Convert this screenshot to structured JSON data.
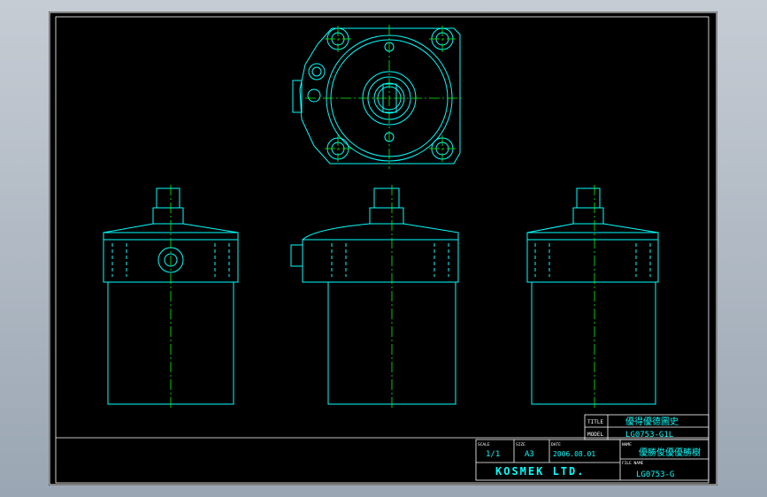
{
  "title_block": {
    "title_label": "TITLE",
    "title_value": "優得優德圖史",
    "model_label": "MODEL",
    "model_value": "LG0753-G1L",
    "scale_label": "SCALE",
    "scale_value": "1/1",
    "size_label": "SIZE",
    "size_value": "A3",
    "date_label": "DATE",
    "date_value": "2006.08.01",
    "name_label": "NAME",
    "name_value": "優勝俊優優勝樹",
    "company": "KOSMEK LTD.",
    "file_label": "FILE NAME",
    "file_value": "LG0753-G"
  },
  "colors": {
    "paper": "#000000",
    "outline": "#00ffff",
    "centerline": "#00ff00",
    "hidden": "#00ffff",
    "frame": "#ffffff"
  },
  "views": [
    "top-view",
    "front-view-left",
    "front-view-center",
    "front-view-right"
  ]
}
